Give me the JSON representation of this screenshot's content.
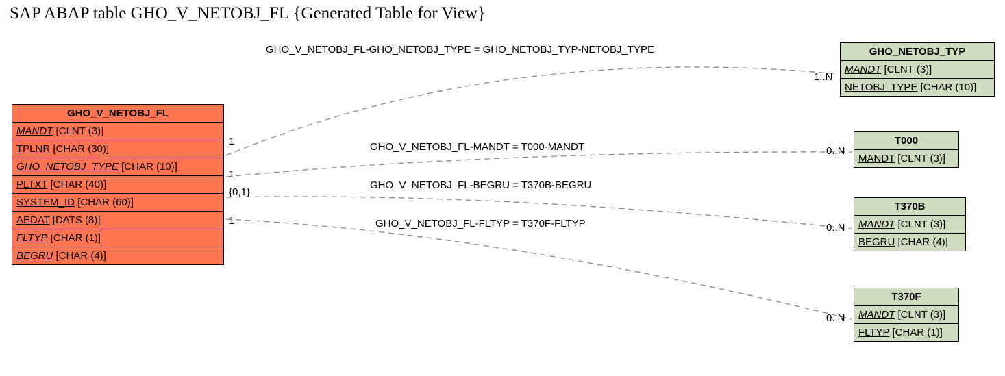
{
  "title": "SAP ABAP table GHO_V_NETOBJ_FL {Generated Table for View}",
  "main_entity": {
    "name": "GHO_V_NETOBJ_FL",
    "fields": [
      {
        "name": "MANDT",
        "type": "[CLNT (3)]",
        "fk": true
      },
      {
        "name": "TPLNR",
        "type": "[CHAR (30)]",
        "fk": false
      },
      {
        "name": "GHO_NETOBJ_TYPE",
        "type": "[CHAR (10)]",
        "fk": true
      },
      {
        "name": "PLTXT",
        "type": "[CHAR (40)]",
        "fk": false
      },
      {
        "name": "SYSTEM_ID",
        "type": "[CHAR (60)]",
        "fk": false
      },
      {
        "name": "AEDAT",
        "type": "[DATS (8)]",
        "fk": false
      },
      {
        "name": "FLTYP",
        "type": "[CHAR (1)]",
        "fk": true
      },
      {
        "name": "BEGRU",
        "type": "[CHAR (4)]",
        "fk": true
      }
    ]
  },
  "targets": [
    {
      "name": "GHO_NETOBJ_TYP",
      "fields": [
        {
          "name": "MANDT",
          "type": "[CLNT (3)]",
          "fk": true
        },
        {
          "name": "NETOBJ_TYPE",
          "type": "[CHAR (10)]",
          "fk": false
        }
      ]
    },
    {
      "name": "T000",
      "fields": [
        {
          "name": "MANDT",
          "type": "[CLNT (3)]",
          "fk": false
        }
      ]
    },
    {
      "name": "T370B",
      "fields": [
        {
          "name": "MANDT",
          "type": "[CLNT (3)]",
          "fk": true
        },
        {
          "name": "BEGRU",
          "type": "[CHAR (4)]",
          "fk": false
        }
      ]
    },
    {
      "name": "T370F",
      "fields": [
        {
          "name": "MANDT",
          "type": "[CLNT (3)]",
          "fk": true
        },
        {
          "name": "FLTYP",
          "type": "[CHAR (1)]",
          "fk": false
        }
      ]
    }
  ],
  "relations": [
    {
      "label": "GHO_V_NETOBJ_FL-GHO_NETOBJ_TYPE = GHO_NETOBJ_TYP-NETOBJ_TYPE",
      "left_card": "1",
      "right_card": "1..N"
    },
    {
      "label": "GHO_V_NETOBJ_FL-MANDT = T000-MANDT",
      "left_card": "1",
      "right_card": "0..N"
    },
    {
      "label": "GHO_V_NETOBJ_FL-BEGRU = T370B-BEGRU",
      "left_card": "{0,1}",
      "right_card": "0..N"
    },
    {
      "label": "GHO_V_NETOBJ_FL-FLTYP = T370F-FLTYP",
      "left_card": "1",
      "right_card": "0..N"
    }
  ]
}
